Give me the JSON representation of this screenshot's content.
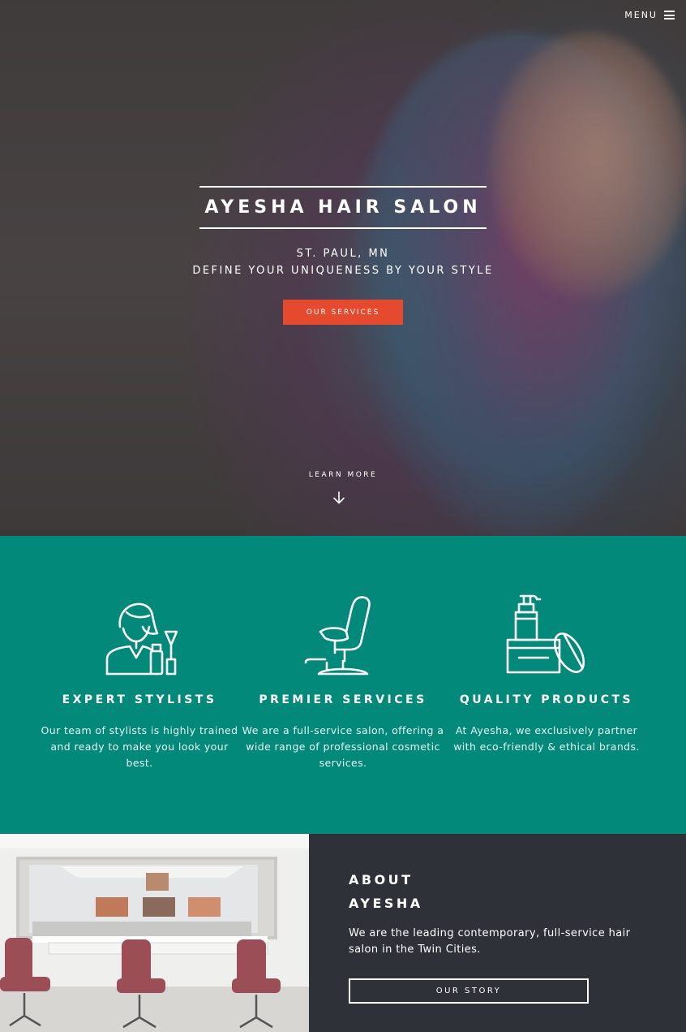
{
  "nav": {
    "menu_label": "MENU"
  },
  "hero": {
    "title": "AYESHA HAIR SALON",
    "location": "ST. PAUL, MN",
    "tagline": "DEFINE YOUR UNIQUENESS BY YOUR STYLE",
    "cta_label": "OUR SERVICES",
    "learn_more_label": "LEARN MORE"
  },
  "features": {
    "items": [
      {
        "icon": "stylist-icon",
        "title": "EXPERT STYLISTS",
        "text": "Our team of stylists is highly trained and ready to make you look your best."
      },
      {
        "icon": "salon-chair-icon",
        "title": "PREMIER SERVICES",
        "text": "We are a full-service salon, offering a wide range of professional cosmetic services."
      },
      {
        "icon": "cosmetic-products-icon",
        "title": "QUALITY PRODUCTS",
        "text": "At Ayesha, we exclusively partner with eco-friendly & ethical brands."
      }
    ]
  },
  "about": {
    "heading_line1": "ABOUT",
    "heading_line2": "AYESHA",
    "text": "We are the leading contemporary, full-service hair salon in the Twin Cities.",
    "cta_label": "OUR STORY"
  },
  "colors": {
    "accent": "#e64a2e",
    "teal": "#02897a",
    "dark": "#2e3138"
  }
}
